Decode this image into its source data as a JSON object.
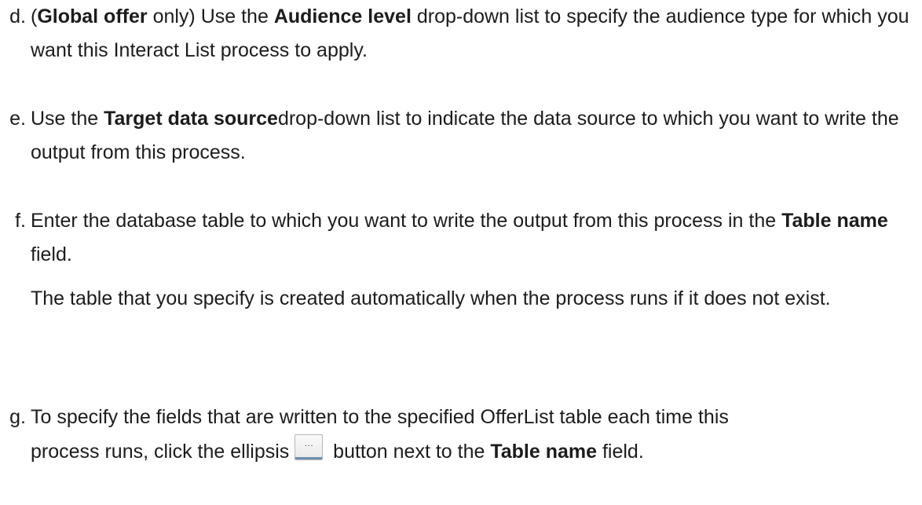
{
  "steps": [
    {
      "marker": "d.",
      "p1": "(",
      "b1": "Global offer",
      "p2": " only) Use the ",
      "b2": "Audience level",
      "p3": " drop-down list to specify the audience type for which you want this Interact List process to apply."
    },
    {
      "marker": "e.",
      "p1": "Use the ",
      "b1": "Target data source",
      "p2": "drop-down list to indicate the data source to which you want to write the output from this process."
    },
    {
      "marker": "f.",
      "p1": "Enter the database table to which you want to write the output from this process in the ",
      "b1": "Table name",
      "p2": " field.",
      "note": "The table that you specify is created automatically when the process runs if it does not exist."
    },
    {
      "marker": "g.",
      "p1": "To specify the fields that are written to the specified OfferList table each time this",
      "p2": "process runs, click the ellipsis ",
      "button_glyph": "…",
      "p3": " button next to the ",
      "b1": "Table name",
      "p4": " field."
    }
  ]
}
